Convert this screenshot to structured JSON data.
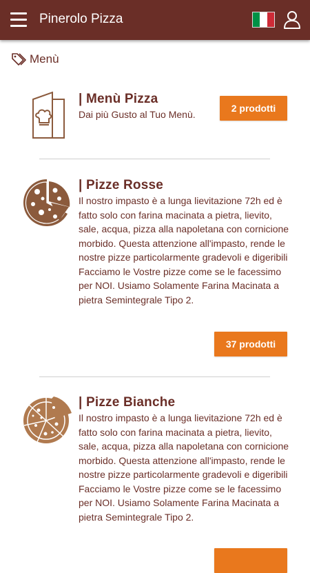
{
  "header": {
    "title": "Pinerolo Pizza",
    "language_flag": "italy-flag"
  },
  "breadcrumb": {
    "label": "Menù"
  },
  "categories": [
    {
      "title": "| Menù Pizza",
      "description": "Dai più Gusto al Tuo Menù.",
      "button": "2 prodotti",
      "icon": "menu-book-icon"
    },
    {
      "title": "| Pizze Rosse",
      "description": "Il nostro impasto è a lunga lievitazione 72h ed è fatto solo con farina macinata a pietra, lievito, sale, acqua, pizza alla napoletana con cornicione morbido. Questa attenzione all'impasto, rende le nostre pizze particolarmente gradevoli e digeribili\nFacciamo le Vostre pizze come se le facessimo per NOI. Usiamo Solamente Farina Macinata a pietra Semintegrale Tipo 2.",
      "button": "37 prodotti",
      "icon": "pizza-red-icon"
    },
    {
      "title": "| Pizze Bianche",
      "description": "Il nostro impasto è a lunga lievitazione 72h ed è fatto solo con farina macinata a pietra, lievito, sale, acqua, pizza alla napoletana con cornicione morbido. Questa attenzione all'impasto, rende le nostre pizze particolarmente gradevoli e digeribili\nFacciamo le Vostre pizze come se le facessimo per NOI. Usiamo Solamente Farina Macinata a pietra Semintegrale Tipo 2.",
      "icon": "pizza-white-icon"
    }
  ],
  "colors": {
    "primary": "#6a2e27",
    "accent": "#e9781d",
    "icon_brown": "#8b5a3c",
    "icon_tan": "#b07a4f"
  }
}
